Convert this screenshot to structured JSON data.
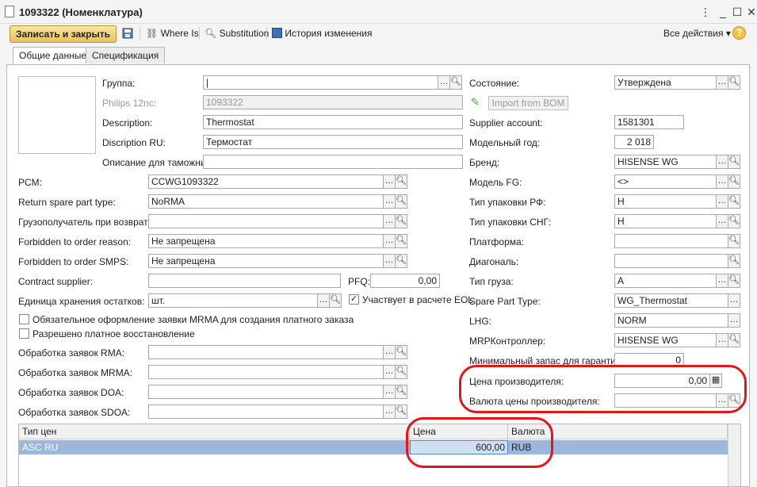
{
  "window": {
    "title": "1093322 (Номенклатура)"
  },
  "toolbar": {
    "save_close": "Записать и закрыть",
    "where_is": "Where Is",
    "substitution": "Substitution",
    "history": "История изменения",
    "all_actions": "Все действия",
    "help": "?"
  },
  "tabs": [
    "Общие данные",
    "Спецификация"
  ],
  "left": {
    "group": {
      "label": "Группа:",
      "value": "|"
    },
    "philips": {
      "label": "Philips 12nc:",
      "value": "1093322"
    },
    "description": {
      "label": "Description:",
      "value": "Thermostat"
    },
    "description_ru": {
      "label": "Discription RU:",
      "value": "Термостат"
    },
    "customs": {
      "label": "Описание для таможни:",
      "value": ""
    },
    "pcm": {
      "label": "PCM:",
      "value": "CCWG1093322"
    },
    "return_type": {
      "label": "Return spare part type:",
      "value": "NoRMA"
    },
    "return_consignee": {
      "label": "Грузополучатель при возврате:",
      "value": ""
    },
    "forbid_reason": {
      "label": "Forbidden to order reason:",
      "value": "Не запрещена"
    },
    "forbid_smps": {
      "label": "Forbidden to order SMPS:",
      "value": "Не запрещена"
    },
    "contract_supplier": {
      "label": "Contract supplier:",
      "value": ""
    },
    "pfq": {
      "label": "PFQ:",
      "value": "0,00"
    },
    "unit": {
      "label": "Единица хранения остатков:",
      "value": "шт."
    },
    "eol": {
      "label": "Участвует в расчете EOL",
      "checked": true
    },
    "mrma_required": {
      "label": "Обязательное оформление заявки MRMA для создания платного заказа",
      "checked": false
    },
    "paid_restore": {
      "label": "Разрешено платное восстановление",
      "checked": false
    },
    "rma": {
      "label": "Обработка заявок RMA:",
      "value": ""
    },
    "mrma": {
      "label": "Обработка заявок MRMA:",
      "value": ""
    },
    "doa": {
      "label": "Обработка заявок DOA:",
      "value": ""
    },
    "sdoa": {
      "label": "Обработка заявок SDOA:",
      "value": ""
    }
  },
  "right": {
    "state": {
      "label": "Состояние:",
      "value": "Утверждена"
    },
    "import_bom": "Import from BOM",
    "supplier_account": {
      "label": "Supplier account:",
      "value": "1581301"
    },
    "model_year": {
      "label": "Модельный год:",
      "value": "2 018"
    },
    "brand": {
      "label": "Бренд:",
      "value": "HISENSE WG"
    },
    "model_fg": {
      "label": "Модель FG:",
      "value": "<>"
    },
    "pack_rf": {
      "label": "Тип упаковки РФ:",
      "value": "Н"
    },
    "pack_cis": {
      "label": "Тип упаковки СНГ:",
      "value": "Н"
    },
    "platform": {
      "label": "Платформа:",
      "value": ""
    },
    "diagonal": {
      "label": "Диагональ:",
      "value": ""
    },
    "cargo": {
      "label": "Тип груза:",
      "value": "A"
    },
    "spare_type": {
      "label": "Spare Part Type:",
      "value": "WG_Thermostat"
    },
    "lhg": {
      "label": "LHG:",
      "value": "NORM"
    },
    "mrp": {
      "label": "MRPКонтроллер:",
      "value": "HISENSE WG"
    },
    "min_stock": {
      "label": "Минимальный запас для гарантии:",
      "value": "0"
    },
    "mfr_price": {
      "label": "Цена производителя:",
      "value": "0,00"
    },
    "mfr_currency": {
      "label": "Валюта цены производителя:",
      "value": ""
    }
  },
  "table": {
    "headers": [
      "Тип цен",
      "Цена",
      "Валюта"
    ],
    "rows": [
      {
        "type": "ASC RU",
        "price": "600,00",
        "currency": "RUB"
      }
    ]
  },
  "colors": {
    "accent": "#e0161c",
    "selected_row": "#9cb7d9",
    "save_button": "#e8c25a"
  }
}
